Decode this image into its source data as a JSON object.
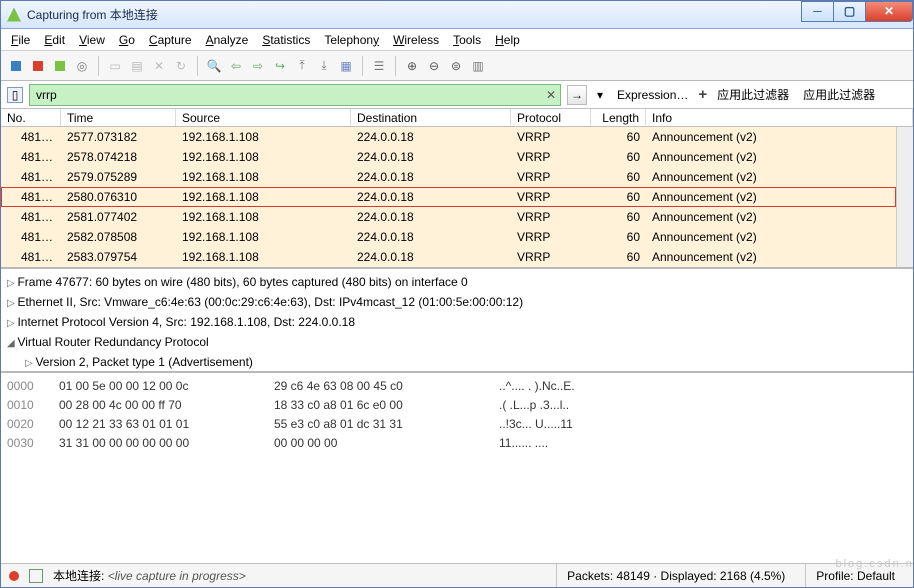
{
  "title": "Capturing from 本地连接",
  "menu": [
    "File",
    "Edit",
    "View",
    "Go",
    "Capture",
    "Analyze",
    "Statistics",
    "Telephony",
    "Wireless",
    "Tools",
    "Help"
  ],
  "filter": {
    "value": "vrrp",
    "clear": "✕",
    "expression": "Expression…",
    "plus": "+",
    "apply": "应用此过滤器",
    "apply2": "应用此过滤器"
  },
  "columns": {
    "no": "No.",
    "time": "Time",
    "source": "Source",
    "destination": "Destination",
    "protocol": "Protocol",
    "length": "Length",
    "info": "Info"
  },
  "packets": [
    {
      "no": "481…",
      "time": "2577.073182",
      "src": "192.168.1.108",
      "dst": "224.0.0.18",
      "proto": "VRRP",
      "len": "60",
      "info": "Announcement (v2)"
    },
    {
      "no": "481…",
      "time": "2578.074218",
      "src": "192.168.1.108",
      "dst": "224.0.0.18",
      "proto": "VRRP",
      "len": "60",
      "info": "Announcement (v2)"
    },
    {
      "no": "481…",
      "time": "2579.075289",
      "src": "192.168.1.108",
      "dst": "224.0.0.18",
      "proto": "VRRP",
      "len": "60",
      "info": "Announcement (v2)"
    },
    {
      "no": "481…",
      "time": "2580.076310",
      "src": "192.168.1.108",
      "dst": "224.0.0.18",
      "proto": "VRRP",
      "len": "60",
      "info": "Announcement (v2)",
      "selected": true
    },
    {
      "no": "481…",
      "time": "2581.077402",
      "src": "192.168.1.108",
      "dst": "224.0.0.18",
      "proto": "VRRP",
      "len": "60",
      "info": "Announcement (v2)"
    },
    {
      "no": "481…",
      "time": "2582.078508",
      "src": "192.168.1.108",
      "dst": "224.0.0.18",
      "proto": "VRRP",
      "len": "60",
      "info": "Announcement (v2)"
    },
    {
      "no": "481…",
      "time": "2583.079754",
      "src": "192.168.1.108",
      "dst": "224.0.0.18",
      "proto": "VRRP",
      "len": "60",
      "info": "Announcement (v2)"
    }
  ],
  "details": [
    "Frame 47677: 60 bytes on wire (480 bits), 60 bytes captured (480 bits) on interface 0",
    "Ethernet II, Src: Vmware_c6:4e:63 (00:0c:29:c6:4e:63), Dst: IPv4mcast_12 (01:00:5e:00:00:12)",
    "Internet Protocol Version 4, Src: 192.168.1.108, Dst: 224.0.0.18",
    "Virtual Router Redundancy Protocol",
    "Version 2, Packet type 1 (Advertisement)"
  ],
  "hex": [
    {
      "off": "0000",
      "b1": "01 00 5e 00 00 12 00 0c",
      "b2": "29 c6 4e 63 08 00 45 c0",
      "asc": "..^.... . ).Nc..E."
    },
    {
      "off": "0010",
      "b1": "00 28 00 4c 00 00 ff 70",
      "b2": "18 33 c0 a8 01 6c e0 00",
      "asc": ".( .L...p .3...l.."
    },
    {
      "off": "0020",
      "b1": "00 12 21 33 63 01 01 01",
      "b2": "55 e3 c0 a8 01 dc 31 31",
      "asc": "..!3c... U.....11"
    },
    {
      "off": "0030",
      "b1": "31 31 00 00 00 00 00 00",
      "b2": "00 00 00 00",
      "asc": "11...... ...."
    }
  ],
  "status": {
    "iface": "本地连接:",
    "live": "<live capture in progress>",
    "packets": "Packets: 48149 · Displayed: 2168 (4.5%)",
    "profile": "Profile: Default"
  },
  "watermark": "blog.csdn.net/"
}
